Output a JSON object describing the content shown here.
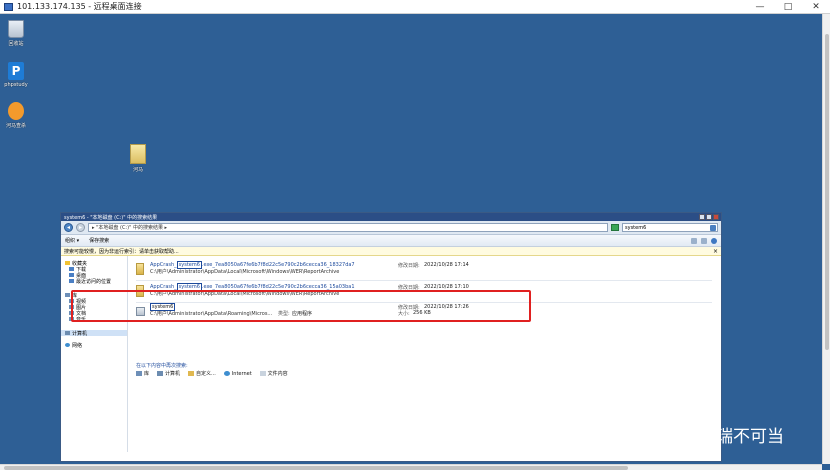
{
  "rdp": {
    "title": "101.133.174.135 - 远程桌面连接",
    "minimize": "—",
    "maximize": "□",
    "close": "✕"
  },
  "desktop": {
    "icons": [
      {
        "label": "回收站"
      },
      {
        "label": "phpstudy"
      },
      {
        "label": "河马查杀"
      },
      {
        "label": "河马"
      }
    ]
  },
  "explorer": {
    "title": "system6 - \"本地磁盘 (C:)\" 中的搜索结果",
    "address": "▸ \"本地磁盘 (C:)\" 中的搜索结果 ▸",
    "search_value": "system6",
    "toolbar": {
      "organize": "组织 ▾",
      "save_search": "保存搜索"
    },
    "infobar": "搜索可能较慢，因为非运行索引：请单击获取帮助...",
    "nav": {
      "favorites": "收藏夹",
      "downloads": "下载",
      "desktop": "桌面",
      "recent": "最近访问的位置",
      "libraries": "库",
      "videos": "视频",
      "pictures": "图片",
      "documents": "文档",
      "music": "音乐",
      "computer": "计算机",
      "network": "网络"
    },
    "results": [
      {
        "name_prefix": "AppCrash_",
        "name_hl": "system6",
        "name_suffix": ".exe_7ea8050a67fe6b7f8d22c5e790c2b6cecca36_18327da7",
        "path": "C:\\用户\\Administrator\\AppData\\Local\\Microsoft\\Windows\\WER\\ReportArchive",
        "date_label": "修改日期:",
        "date": "2022/10/28 17:14"
      },
      {
        "name_prefix": "AppCrash_",
        "name_hl": "system6",
        "name_suffix": ".exe_7ea8050a67fe6b7f8d22c5e790c2b6cecca36_15a03ba1",
        "path": "C:\\用户\\Administrator\\AppData\\Local\\Microsoft\\Windows\\WER\\ReportArchive",
        "date_label": "修改日期:",
        "date": "2022/10/28 17:10"
      },
      {
        "name_hl": "system6",
        "path": "C:\\用户\\Administrator\\AppData\\Roaming\\Micros...",
        "type_label": "类型:",
        "type": "应用程序",
        "date_label": "修改日期:",
        "date": "2022/10/28 17:26",
        "size_label": "大小:",
        "size": "256 KB"
      }
    ],
    "search_again": "在以下内容中再次搜索:",
    "search_again_links": [
      "库",
      "计算机",
      "自定义...",
      "Internet",
      "文件内容"
    ]
  },
  "watermark": "瑞不可当"
}
